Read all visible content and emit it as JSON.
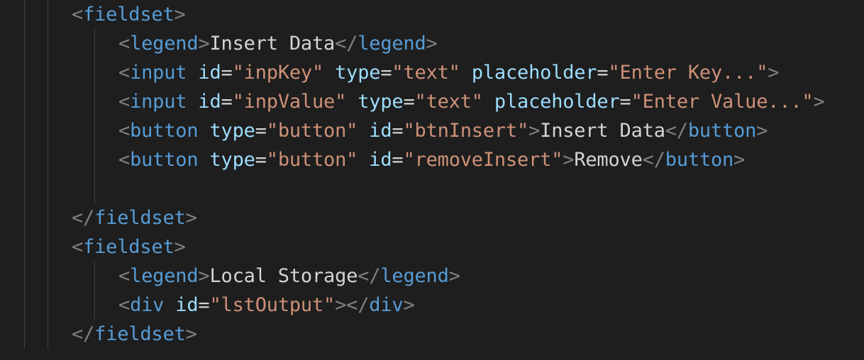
{
  "editor": {
    "language": "html",
    "theme_colors": {
      "background": "#1e1e1e",
      "tag": "#569cd6",
      "attribute": "#9cdcfe",
      "string": "#ce9178",
      "text": "#d4d4d4",
      "punctuation": "#808080",
      "indent_guide": "#404040"
    },
    "lines": [
      {
        "indent": 1,
        "tokens": [
          {
            "t": "punct",
            "v": "<"
          },
          {
            "t": "tag",
            "v": "fieldset"
          },
          {
            "t": "punct",
            "v": ">"
          }
        ]
      },
      {
        "indent": 2,
        "tokens": [
          {
            "t": "punct",
            "v": "<"
          },
          {
            "t": "tag",
            "v": "legend"
          },
          {
            "t": "punct",
            "v": ">"
          },
          {
            "t": "text",
            "v": "Insert Data"
          },
          {
            "t": "punct",
            "v": "</"
          },
          {
            "t": "tag",
            "v": "legend"
          },
          {
            "t": "punct",
            "v": ">"
          }
        ]
      },
      {
        "indent": 2,
        "tokens": [
          {
            "t": "punct",
            "v": "<"
          },
          {
            "t": "tag",
            "v": "input"
          },
          {
            "t": "text",
            "v": " "
          },
          {
            "t": "attr",
            "v": "id"
          },
          {
            "t": "text",
            "v": "="
          },
          {
            "t": "str",
            "v": "\"inpKey\""
          },
          {
            "t": "text",
            "v": " "
          },
          {
            "t": "attr",
            "v": "type"
          },
          {
            "t": "text",
            "v": "="
          },
          {
            "t": "str",
            "v": "\"text\""
          },
          {
            "t": "text",
            "v": " "
          },
          {
            "t": "attr",
            "v": "placeholder"
          },
          {
            "t": "text",
            "v": "="
          },
          {
            "t": "str",
            "v": "\"Enter Key...\""
          },
          {
            "t": "punct",
            "v": ">"
          }
        ]
      },
      {
        "indent": 2,
        "tokens": [
          {
            "t": "punct",
            "v": "<"
          },
          {
            "t": "tag",
            "v": "input"
          },
          {
            "t": "text",
            "v": " "
          },
          {
            "t": "attr",
            "v": "id"
          },
          {
            "t": "text",
            "v": "="
          },
          {
            "t": "str",
            "v": "\"inpValue\""
          },
          {
            "t": "text",
            "v": " "
          },
          {
            "t": "attr",
            "v": "type"
          },
          {
            "t": "text",
            "v": "="
          },
          {
            "t": "str",
            "v": "\"text\""
          },
          {
            "t": "text",
            "v": " "
          },
          {
            "t": "attr",
            "v": "placeholder"
          },
          {
            "t": "text",
            "v": "="
          },
          {
            "t": "str",
            "v": "\"Enter Value...\""
          },
          {
            "t": "punct",
            "v": ">"
          }
        ]
      },
      {
        "indent": 2,
        "tokens": [
          {
            "t": "punct",
            "v": "<"
          },
          {
            "t": "tag",
            "v": "button"
          },
          {
            "t": "text",
            "v": " "
          },
          {
            "t": "attr",
            "v": "type"
          },
          {
            "t": "text",
            "v": "="
          },
          {
            "t": "str",
            "v": "\"button\""
          },
          {
            "t": "text",
            "v": " "
          },
          {
            "t": "attr",
            "v": "id"
          },
          {
            "t": "text",
            "v": "="
          },
          {
            "t": "str",
            "v": "\"btnInsert\""
          },
          {
            "t": "punct",
            "v": ">"
          },
          {
            "t": "text",
            "v": "Insert Data"
          },
          {
            "t": "punct",
            "v": "</"
          },
          {
            "t": "tag",
            "v": "button"
          },
          {
            "t": "punct",
            "v": ">"
          }
        ]
      },
      {
        "indent": 2,
        "tokens": [
          {
            "t": "punct",
            "v": "<"
          },
          {
            "t": "tag",
            "v": "button"
          },
          {
            "t": "text",
            "v": " "
          },
          {
            "t": "attr",
            "v": "type"
          },
          {
            "t": "text",
            "v": "="
          },
          {
            "t": "str",
            "v": "\"button\""
          },
          {
            "t": "text",
            "v": " "
          },
          {
            "t": "attr",
            "v": "id"
          },
          {
            "t": "text",
            "v": "="
          },
          {
            "t": "str",
            "v": "\"removeInsert\""
          },
          {
            "t": "punct",
            "v": ">"
          },
          {
            "t": "text",
            "v": "Remove"
          },
          {
            "t": "punct",
            "v": "</"
          },
          {
            "t": "tag",
            "v": "button"
          },
          {
            "t": "punct",
            "v": ">"
          }
        ]
      },
      {
        "indent": 2,
        "tokens": []
      },
      {
        "indent": 1,
        "tokens": [
          {
            "t": "punct",
            "v": "</"
          },
          {
            "t": "tag",
            "v": "fieldset"
          },
          {
            "t": "punct",
            "v": ">"
          }
        ]
      },
      {
        "indent": 1,
        "tokens": [
          {
            "t": "punct",
            "v": "<"
          },
          {
            "t": "tag",
            "v": "fieldset"
          },
          {
            "t": "punct",
            "v": ">"
          }
        ]
      },
      {
        "indent": 2,
        "tokens": [
          {
            "t": "punct",
            "v": "<"
          },
          {
            "t": "tag",
            "v": "legend"
          },
          {
            "t": "punct",
            "v": ">"
          },
          {
            "t": "text",
            "v": "Local Storage"
          },
          {
            "t": "punct",
            "v": "</"
          },
          {
            "t": "tag",
            "v": "legend"
          },
          {
            "t": "punct",
            "v": ">"
          }
        ]
      },
      {
        "indent": 2,
        "tokens": [
          {
            "t": "punct",
            "v": "<"
          },
          {
            "t": "tag",
            "v": "div"
          },
          {
            "t": "text",
            "v": " "
          },
          {
            "t": "attr",
            "v": "id"
          },
          {
            "t": "text",
            "v": "="
          },
          {
            "t": "str",
            "v": "\"lstOutput\""
          },
          {
            "t": "punct",
            "v": "></"
          },
          {
            "t": "tag",
            "v": "div"
          },
          {
            "t": "punct",
            "v": ">"
          }
        ]
      },
      {
        "indent": 1,
        "tokens": [
          {
            "t": "punct",
            "v": "</"
          },
          {
            "t": "tag",
            "v": "fieldset"
          },
          {
            "t": "punct",
            "v": ">"
          }
        ]
      }
    ]
  }
}
